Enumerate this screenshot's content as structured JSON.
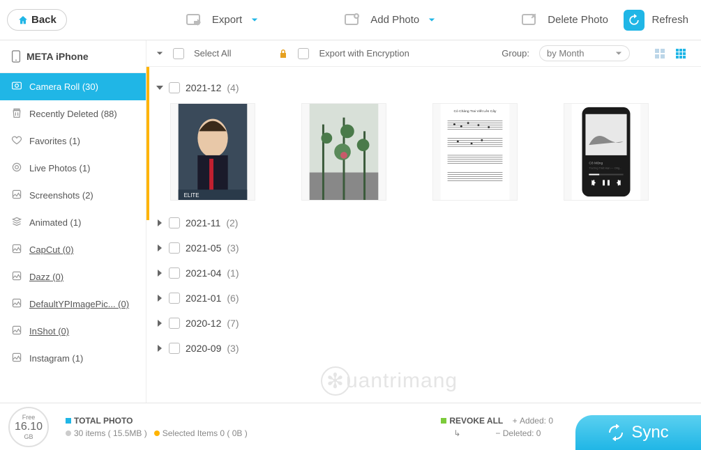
{
  "back_label": "Back",
  "toolbar": {
    "export": "Export",
    "add_photo": "Add Photo",
    "delete_photo": "Delete Photo",
    "refresh": "Refresh"
  },
  "device_name": "META iPhone",
  "sidebar": [
    {
      "label": "Camera Roll (30)",
      "active": true
    },
    {
      "label": "Recently Deleted (88)"
    },
    {
      "label": "Favorites (1)"
    },
    {
      "label": "Live Photos (1)"
    },
    {
      "label": "Screenshots (2)"
    },
    {
      "label": "Animated (1)"
    },
    {
      "label": "CapCut (0)",
      "ul": true
    },
    {
      "label": "Dazz (0)",
      "ul": true
    },
    {
      "label": "DefaultYPImagePic... (0)",
      "ul": true
    },
    {
      "label": "InShot (0)",
      "ul": true
    },
    {
      "label": "Instagram (1)"
    }
  ],
  "subtoolbar": {
    "select_all": "Select All",
    "export_encryption": "Export with Encryption",
    "group_label": "Group:",
    "group_value": "by Month"
  },
  "groups": [
    {
      "name": "2021-12",
      "count": "(4)",
      "open": true
    },
    {
      "name": "2021-11",
      "count": "(2)"
    },
    {
      "name": "2021-05",
      "count": "(3)"
    },
    {
      "name": "2021-04",
      "count": "(1)"
    },
    {
      "name": "2021-01",
      "count": "(6)"
    },
    {
      "name": "2020-12",
      "count": "(7)"
    },
    {
      "name": "2020-09",
      "count": "(3)"
    }
  ],
  "storage": {
    "free_label": "Free",
    "free_value": "16.10",
    "unit": "GB"
  },
  "footer": {
    "total_photo": "TOTAL PHOTO",
    "items_line": "30 items ( 15.5MB )",
    "selected_line": "Selected Items 0 ( 0B )",
    "revoke_all": "REVOKE ALL",
    "added": "Added: 0",
    "deleted": "Deleted: 0",
    "sync": "Sync"
  },
  "watermark": "uantrimang"
}
